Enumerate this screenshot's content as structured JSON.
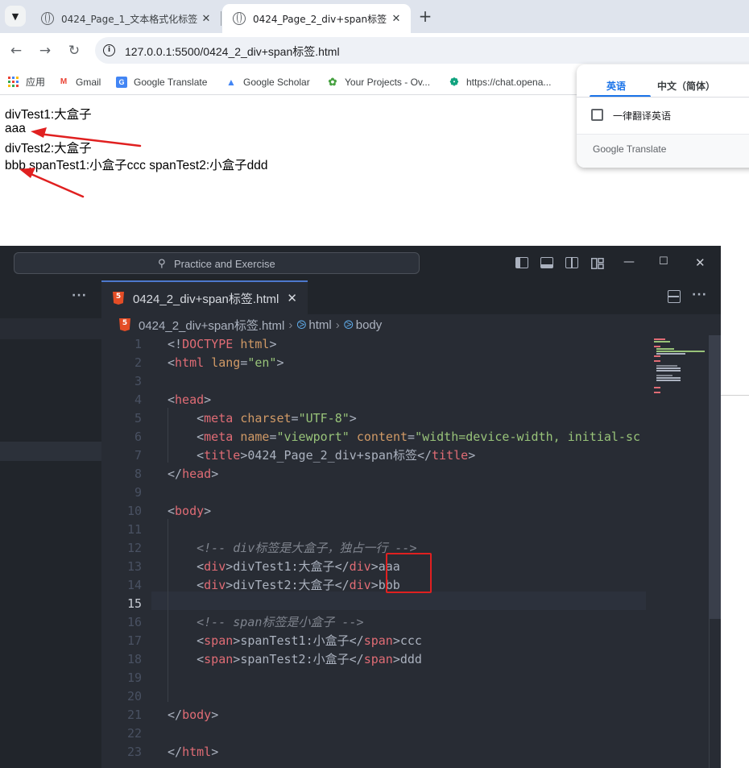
{
  "browser": {
    "tabs": [
      {
        "title": "0424_Page_1_文本格式化标签",
        "active": false
      },
      {
        "title": "0424_Page_2_div+span标签",
        "active": true
      }
    ],
    "url": "127.0.0.1:5500/0424_2_div+span标签.html",
    "bookmarks": [
      {
        "label": "应用",
        "icon": "apps-grid-icon"
      },
      {
        "label": "Gmail",
        "icon": "gmail-icon"
      },
      {
        "label": "Google Translate",
        "icon": "google-translate-icon"
      },
      {
        "label": "Google Scholar",
        "icon": "google-scholar-icon"
      },
      {
        "label": "Your Projects - Ov...",
        "icon": "overleaf-icon"
      },
      {
        "label": "https://chat.opena...",
        "icon": "openai-icon"
      }
    ]
  },
  "page": {
    "lines": [
      "divTest1:大盒子",
      "aaa",
      "divTest2:大盒子",
      "bbb spanTest1:小盒子ccc spanTest2:小盒子ddd"
    ]
  },
  "translate_popup": {
    "tab_english": "英语",
    "tab_chinese": "中文（简体）",
    "checkbox_label": "一律翻译英语",
    "brand": "Google Translate"
  },
  "vscode": {
    "search": "Practice and Exercise",
    "tab_title": "0424_2_div+span标签.html",
    "breadcrumb": [
      "0424_2_div+span标签.html",
      "html",
      "body"
    ],
    "line_numbers": [
      "1",
      "2",
      "3",
      "4",
      "5",
      "6",
      "7",
      "8",
      "9",
      "10",
      "11",
      "12",
      "13",
      "14",
      "15",
      "16",
      "17",
      "18",
      "19",
      "20",
      "21",
      "22",
      "23"
    ],
    "active_line": "15"
  },
  "colors": {
    "annotation_red": "#e02020",
    "tab_accent": "#4d78cc",
    "editor_bg": "#282c34"
  }
}
